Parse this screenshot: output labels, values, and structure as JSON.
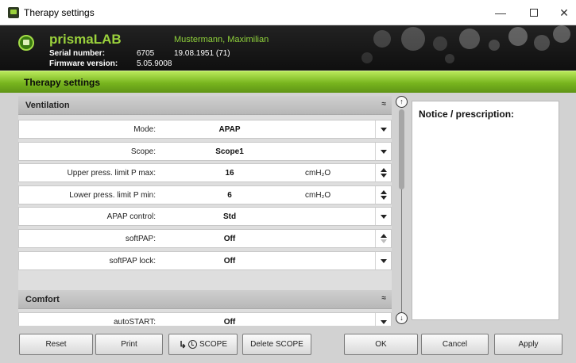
{
  "window": {
    "title": "Therapy settings",
    "minimize_glyph": "—",
    "close_glyph": "✕"
  },
  "header": {
    "device": "prismaLAB",
    "serial_label": "Serial number:",
    "serial_value": "6705",
    "firmware_label": "Firmware version:",
    "firmware_value": "5.05.9008",
    "patient_name": "Mustermann, Maximilian",
    "patient_dob": "19.08.1951  (71)"
  },
  "page_title": "Therapy settings",
  "sections": {
    "ventilation": {
      "title": "Ventilation",
      "collapse_glyph": "≈",
      "rows": [
        {
          "label": "Mode:",
          "value": "APAP",
          "unit": "",
          "control": "dropdown"
        },
        {
          "label": "Scope:",
          "value": "Scope1",
          "unit": "",
          "control": "dropdown"
        },
        {
          "label": "Upper press. limit P max:",
          "value": "16",
          "unit": "cmH₂O",
          "control": "spinner"
        },
        {
          "label": "Lower press. limit P min:",
          "value": "6",
          "unit": "cmH₂O",
          "control": "spinner"
        },
        {
          "label": "APAP control:",
          "value": "Std",
          "unit": "",
          "control": "dropdown"
        },
        {
          "label": "softPAP:",
          "value": "Off",
          "unit": "",
          "control": "spinner-up-only"
        },
        {
          "label": "softPAP lock:",
          "value": "Off",
          "unit": "",
          "control": "dropdown"
        }
      ]
    },
    "comfort": {
      "title": "Comfort",
      "collapse_glyph": "≈",
      "rows": [
        {
          "label": "autoSTART:",
          "value": "Off",
          "unit": "",
          "control": "dropdown"
        }
      ]
    }
  },
  "scrollbar": {
    "up_glyph": "↑",
    "down_glyph": "↓"
  },
  "notice": {
    "title": "Notice / prescription:"
  },
  "buttons": {
    "reset": "Reset",
    "print": "Print",
    "scope": "SCOPE",
    "delete_scope": "Delete SCOPE",
    "ok": "OK",
    "cancel": "Cancel",
    "apply": "Apply"
  },
  "colors": {
    "accent_green": "#9bd23c",
    "header_dark": "#141414",
    "bar_green": "#78b51e"
  }
}
